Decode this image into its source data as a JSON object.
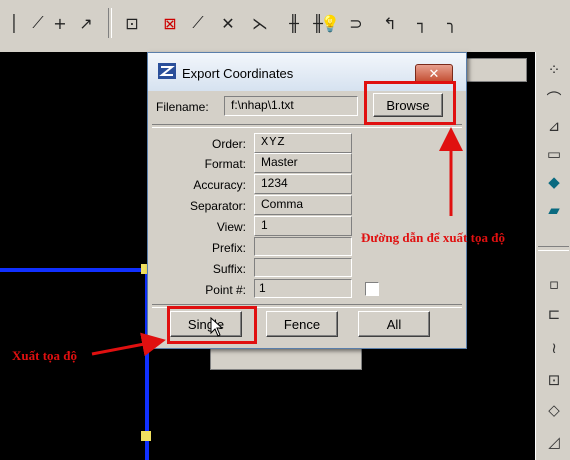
{
  "dialog": {
    "title": "Export Coordinates",
    "close_glyph": "✕",
    "filename_label": "Filename:",
    "filename_value": "f:\\nhap\\1.txt",
    "browse_label": "Browse",
    "fields": [
      {
        "label": "Order:",
        "value": "XYZ"
      },
      {
        "label": "Format:",
        "value": "Master"
      },
      {
        "label": "Accuracy:",
        "value": "1234"
      },
      {
        "label": "Separator:",
        "value": "Comma"
      },
      {
        "label": "View:",
        "value": "1"
      },
      {
        "label": "Prefix:",
        "value": ""
      },
      {
        "label": "Suffix:",
        "value": ""
      },
      {
        "label": "Point #:",
        "value": "1"
      }
    ],
    "buttons": {
      "single": "Single",
      "fence": "Fence",
      "all": "All"
    }
  },
  "annotations": {
    "browse_note": "Đường dẫn để xuất tọa độ",
    "single_note": "Xuất tọa độ",
    "color": "#e01010"
  },
  "toolbar_icons": [
    "line-icon",
    "double-line-icon",
    "plus-icon",
    "curve-icon",
    "move-icon",
    "delete-element-icon",
    "slash-line-icon",
    "cross-icon",
    "vertex-icon",
    "grid-icon",
    "grid-light-icon",
    "bulb-icon",
    "arc-icon",
    "insert-icon",
    "corner-icon",
    "round-corner-icon"
  ],
  "palette_icons": [
    "dots-icon",
    "arc-tool-icon",
    "ruler-icon",
    "measure-icon",
    "fill-icon",
    "shape-icon",
    "small-box-icon",
    "box-corner-icon",
    "wave-icon",
    "frame-icon",
    "diamond-icon",
    "triangle-ruler-icon"
  ]
}
